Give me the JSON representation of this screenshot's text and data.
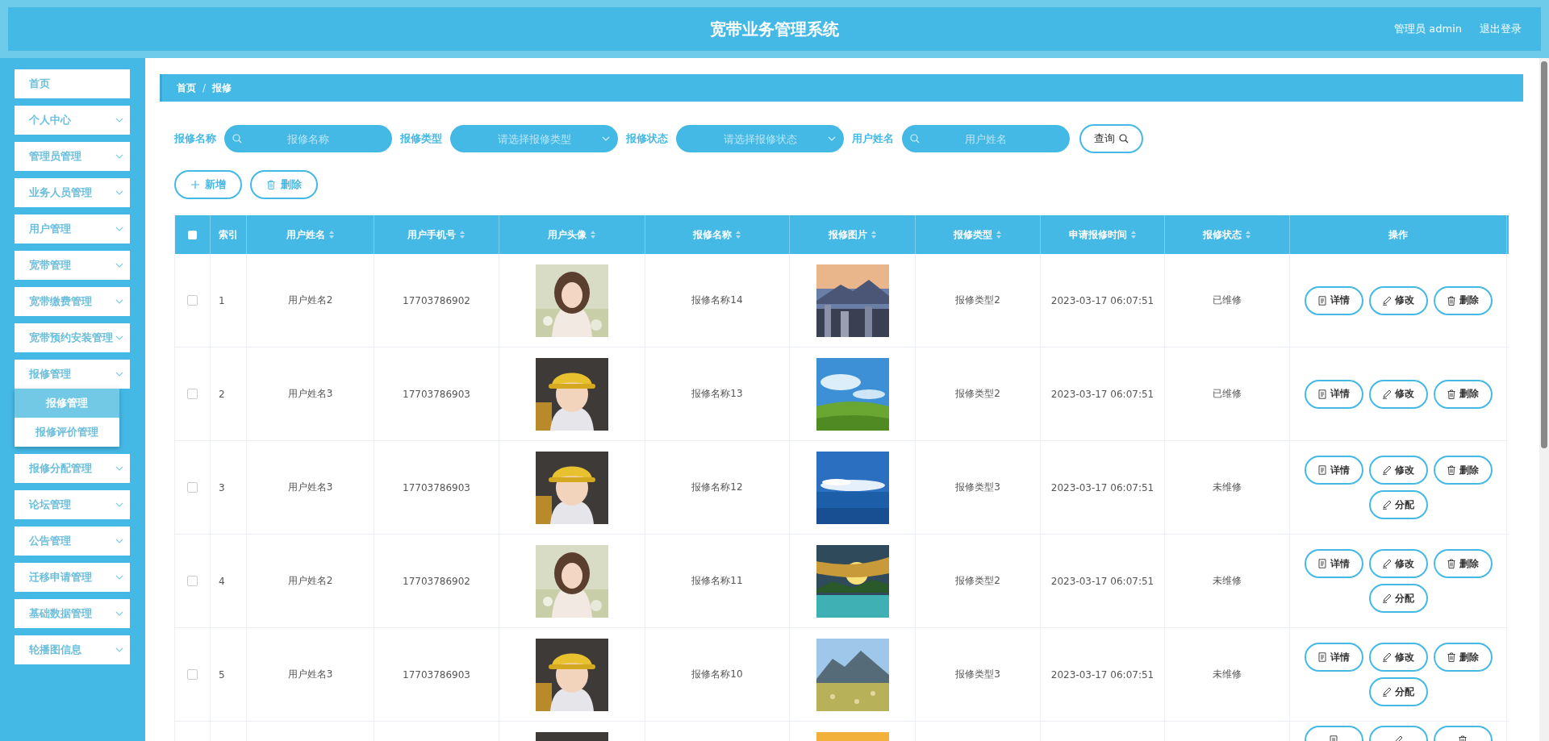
{
  "header": {
    "title": "宽带业务管理系统",
    "user": "管理员 admin",
    "logout": "退出登录"
  },
  "sidebar": {
    "items": [
      {
        "label": "首页",
        "expandable": false
      },
      {
        "label": "个人中心",
        "expandable": true
      },
      {
        "label": "管理员管理",
        "expandable": true
      },
      {
        "label": "业务人员管理",
        "expandable": true
      },
      {
        "label": "用户管理",
        "expandable": true
      },
      {
        "label": "宽带管理",
        "expandable": true
      },
      {
        "label": "宽带缴费管理",
        "expandable": true
      },
      {
        "label": "宽带预约安装管理",
        "expandable": true
      },
      {
        "label": "报修管理",
        "expandable": true,
        "expanded": true,
        "children": [
          {
            "label": "报修管理",
            "selected": true
          },
          {
            "label": "报修评价管理",
            "selected": false
          }
        ]
      },
      {
        "label": "报修分配管理",
        "expandable": true
      },
      {
        "label": "论坛管理",
        "expandable": true
      },
      {
        "label": "公告管理",
        "expandable": true
      },
      {
        "label": "迁移申请管理",
        "expandable": true
      },
      {
        "label": "基础数据管理",
        "expandable": true
      },
      {
        "label": "轮播图信息",
        "expandable": true
      }
    ]
  },
  "breadcrumb": {
    "separator": "/",
    "items": [
      "首页",
      "报修"
    ]
  },
  "filters": [
    {
      "label": "报修名称",
      "kind": "search",
      "placeholder": "报修名称"
    },
    {
      "label": "报修类型",
      "kind": "select",
      "placeholder": "请选择报修类型"
    },
    {
      "label": "报修状态",
      "kind": "select",
      "placeholder": "请选择报修状态"
    },
    {
      "label": "用户姓名",
      "kind": "search",
      "placeholder": "用户姓名"
    }
  ],
  "query_button": "查询",
  "toolbar": [
    {
      "kind": "add",
      "label": "新增"
    },
    {
      "kind": "delete",
      "label": "删除"
    }
  ],
  "table": {
    "all_checked": false,
    "columns": [
      {
        "label": "索引",
        "sortable": false
      },
      {
        "label": "用户姓名",
        "sortable": true
      },
      {
        "label": "用户手机号",
        "sortable": true
      },
      {
        "label": "用户头像",
        "sortable": true
      },
      {
        "label": "报修名称",
        "sortable": true
      },
      {
        "label": "报修图片",
        "sortable": true
      },
      {
        "label": "报修类型",
        "sortable": true
      },
      {
        "label": "申请报修时间",
        "sortable": true
      },
      {
        "label": "报修状态",
        "sortable": true
      },
      {
        "label": "操作",
        "sortable": false
      }
    ],
    "rows": [
      {
        "checked": false,
        "index": "1",
        "user": "用户姓名2",
        "phone": "17703786902",
        "avatar": {
          "kind": "picture"
        },
        "name": "报修名称14",
        "image": {
          "kind": "picture"
        },
        "type": "报修类型2",
        "time": "2023-03-17 06:07:51",
        "status": "已维修",
        "actions": [
          {
            "kind": "detail",
            "label": "详情"
          },
          {
            "kind": "edit",
            "label": "修改"
          },
          {
            "kind": "delete",
            "label": "删除"
          }
        ]
      },
      {
        "checked": false,
        "index": "2",
        "user": "用户姓名3",
        "phone": "17703786903",
        "avatar": {
          "kind": "picture"
        },
        "name": "报修名称13",
        "image": {
          "kind": "picture"
        },
        "type": "报修类型2",
        "time": "2023-03-17 06:07:51",
        "status": "已维修",
        "actions": [
          {
            "kind": "detail",
            "label": "详情"
          },
          {
            "kind": "edit",
            "label": "修改"
          },
          {
            "kind": "delete",
            "label": "删除"
          }
        ]
      },
      {
        "checked": false,
        "index": "3",
        "user": "用户姓名3",
        "phone": "17703786903",
        "avatar": {
          "kind": "picture"
        },
        "name": "报修名称12",
        "image": {
          "kind": "picture"
        },
        "type": "报修类型3",
        "time": "2023-03-17 06:07:51",
        "status": "未维修",
        "actions": [
          {
            "kind": "detail",
            "label": "详情"
          },
          {
            "kind": "edit",
            "label": "修改"
          },
          {
            "kind": "delete",
            "label": "删除"
          },
          {
            "kind": "assign",
            "label": "分配"
          }
        ]
      },
      {
        "checked": false,
        "index": "4",
        "user": "用户姓名2",
        "phone": "17703786902",
        "avatar": {
          "kind": "picture"
        },
        "name": "报修名称11",
        "image": {
          "kind": "picture"
        },
        "type": "报修类型2",
        "time": "2023-03-17 06:07:51",
        "status": "未维修",
        "actions": [
          {
            "kind": "detail",
            "label": "详情"
          },
          {
            "kind": "edit",
            "label": "修改"
          },
          {
            "kind": "delete",
            "label": "删除"
          },
          {
            "kind": "assign",
            "label": "分配"
          }
        ]
      },
      {
        "checked": false,
        "index": "5",
        "user": "用户姓名3",
        "phone": "17703786903",
        "avatar": {
          "kind": "picture"
        },
        "name": "报修名称10",
        "image": {
          "kind": "picture"
        },
        "type": "报修类型3",
        "time": "2023-03-17 06:07:51",
        "status": "未维修",
        "actions": [
          {
            "kind": "detail",
            "label": "详情"
          },
          {
            "kind": "edit",
            "label": "修改"
          },
          {
            "kind": "delete",
            "label": "删除"
          },
          {
            "kind": "assign",
            "label": "分配"
          }
        ]
      },
      {
        "avatar": {
          "kind": "picture"
        },
        "image": {
          "kind": "picture"
        },
        "actions": [
          {
            "kind": "detail"
          },
          {
            "kind": "edit"
          },
          {
            "kind": "delete"
          }
        ]
      }
    ]
  }
}
